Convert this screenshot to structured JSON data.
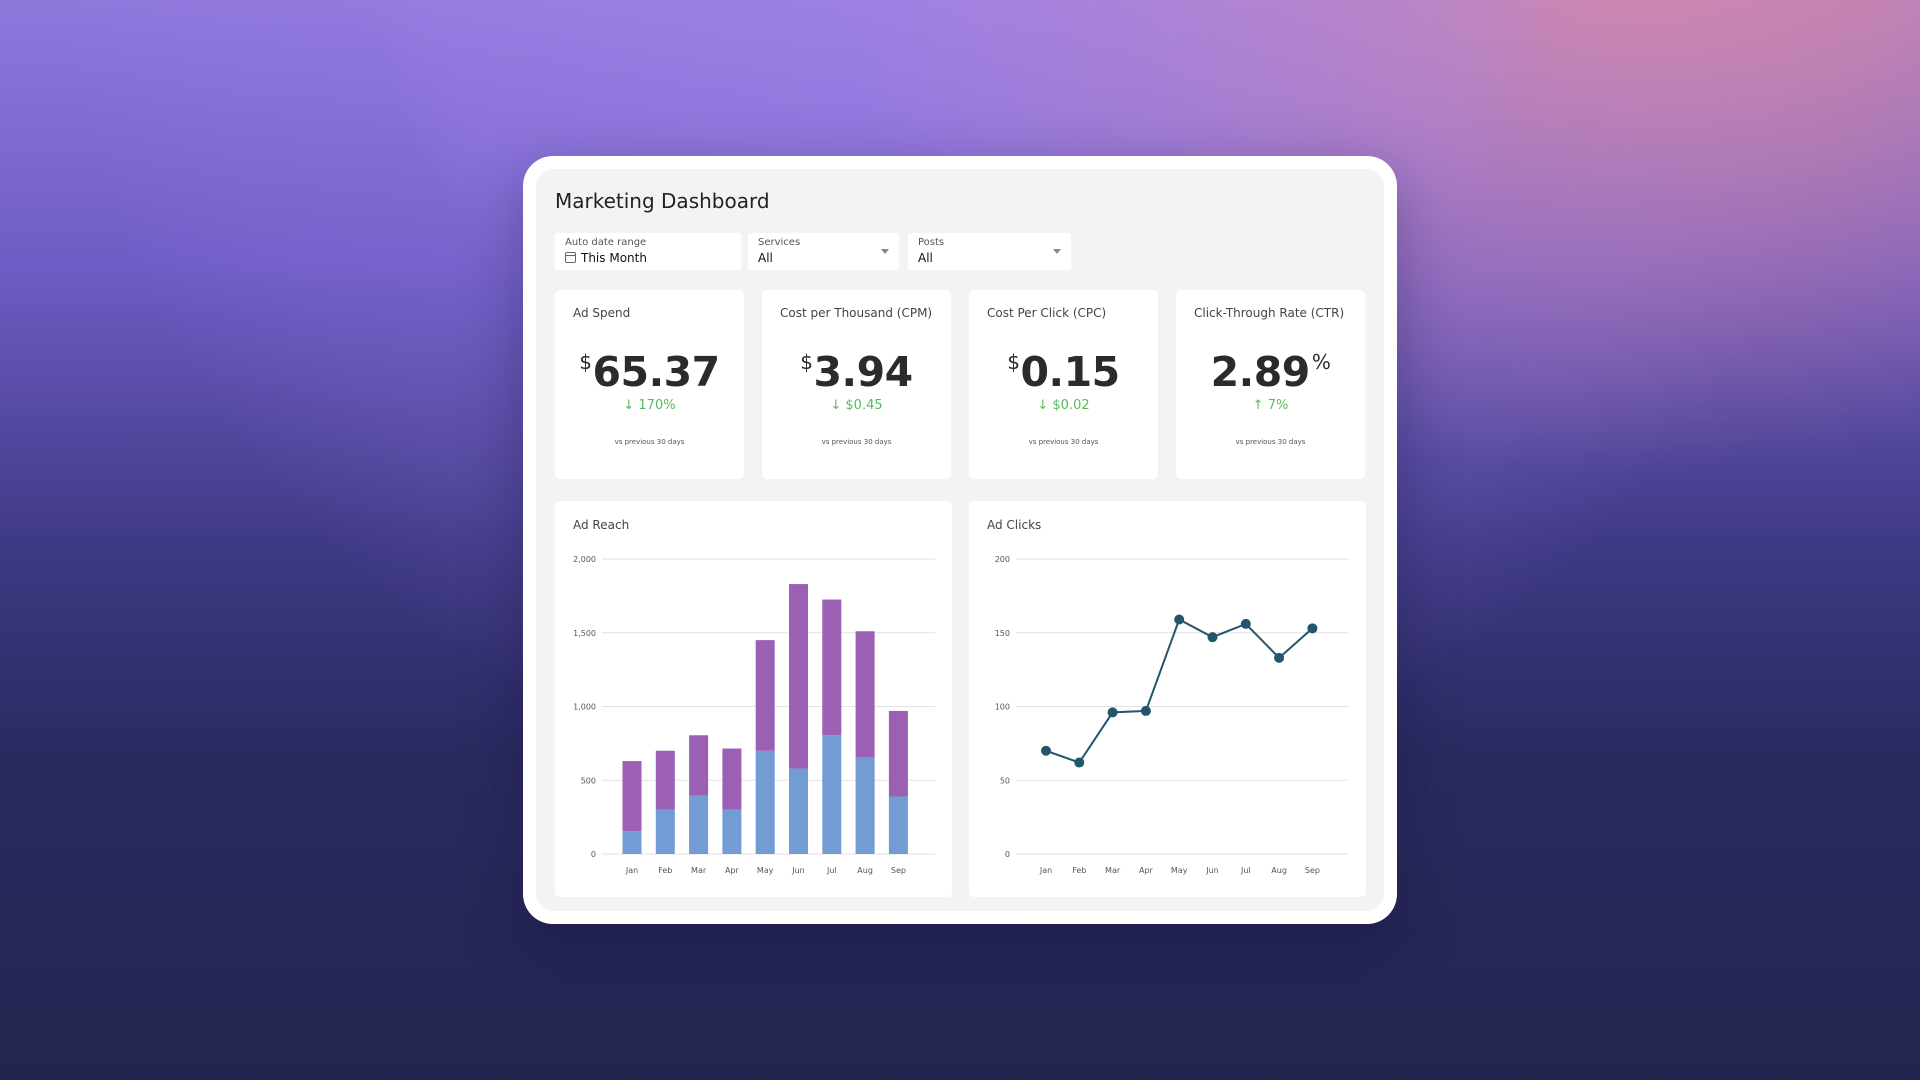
{
  "dashboard": {
    "title": "Marketing Dashboard"
  },
  "filters": {
    "date_range": {
      "label": "Auto date range",
      "value": "This Month",
      "icon": "calendar-icon"
    },
    "services": {
      "label": "Services",
      "value": "All"
    },
    "posts": {
      "label": "Posts",
      "value": "All"
    }
  },
  "kpis": [
    {
      "label": "Ad Spend",
      "prefix": "$",
      "value": "65.37",
      "suffix": "",
      "delta": "↓ 170%",
      "sub": "vs previous 30 days"
    },
    {
      "label": "Cost per Thousand (CPM)",
      "prefix": "$",
      "value": "3.94",
      "suffix": "",
      "delta": "↓ $0.45",
      "sub": "vs previous 30 days"
    },
    {
      "label": "Cost Per Click (CPC)",
      "prefix": "$",
      "value": "0.15",
      "suffix": "",
      "delta": "↓ $0.02",
      "sub": "vs previous 30 days"
    },
    {
      "label": "Click-Through Rate (CTR)",
      "prefix": "",
      "value": "2.89",
      "suffix": "%",
      "delta": "↑ 7%",
      "sub": "vs previous 30 days"
    }
  ],
  "colors": {
    "delta_positive": "#5cb85c",
    "bar_bottom": "#739bd4",
    "bar_top": "#9b5fb4",
    "line": "#24566b"
  },
  "chart_data": [
    {
      "type": "bar",
      "stacked": true,
      "title": "Ad Reach",
      "categories": [
        "Jan",
        "Feb",
        "Mar",
        "Apr",
        "May",
        "Jun",
        "Jul",
        "Aug",
        "Sep"
      ],
      "series": [
        {
          "values": [
            155,
            300,
            395,
            300,
            700,
            580,
            805,
            655,
            390
          ]
        },
        {
          "values": [
            475,
            400,
            410,
            415,
            750,
            1250,
            920,
            855,
            580
          ]
        }
      ],
      "ylim": [
        0,
        2000
      ],
      "yticks": [
        0,
        500,
        1000,
        1500,
        2000
      ],
      "ytick_labels": [
        "0",
        "500",
        "1,000",
        "1,500",
        "2,000"
      ],
      "grid": true,
      "legend": "none"
    },
    {
      "type": "line",
      "title": "Ad Clicks",
      "categories": [
        "Jan",
        "Feb",
        "Mar",
        "Apr",
        "May",
        "Jun",
        "Jul",
        "Aug",
        "Sep"
      ],
      "series": [
        {
          "values": [
            70,
            62,
            96,
            97,
            159,
            147,
            156,
            133,
            153
          ]
        }
      ],
      "ylim": [
        0,
        200
      ],
      "yticks": [
        0,
        50,
        100,
        150,
        200
      ],
      "ytick_labels": [
        "0",
        "50",
        "100",
        "150",
        "200"
      ],
      "grid": true,
      "legend": "none"
    }
  ]
}
